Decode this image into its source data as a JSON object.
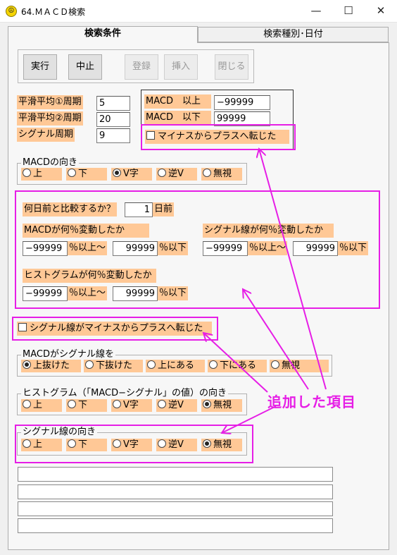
{
  "window": {
    "title": "64.ＭＡＣＤ検索",
    "app_icon_glyph": "☮",
    "minimize_glyph": "—",
    "maximize_glyph": "☐",
    "close_glyph": "✕"
  },
  "tabs": [
    "検索条件",
    "検索種別･日付"
  ],
  "buttons": {
    "run": "実行",
    "stop": "中止",
    "register": "登録",
    "insert": "挿入",
    "close": "閉じる"
  },
  "periods": {
    "smooth1_label": "平滑平均①周期",
    "smooth1_value": "5",
    "smooth2_label": "平滑平均②周期",
    "smooth2_value": "20",
    "signal_label": "シグナル周期",
    "signal_value": "9"
  },
  "macd_range": {
    "upper_label": "MACD　以上",
    "upper_value": "−99999",
    "lower_label": "MACD　以下",
    "lower_value": "99999",
    "minus_to_plus_label": "マイナスからプラスへ転じた"
  },
  "macd_direction": {
    "title": "MACDの向き",
    "options": [
      "上",
      "下",
      "V字",
      "逆V",
      "無視"
    ],
    "selected": 2
  },
  "compare": {
    "question_label": "何日前と比較するか？",
    "days_value": "1",
    "days_unit": "日前",
    "macd_change_label": "MACDが何％変動したか",
    "macd_min": "−99999",
    "macd_min_suffix": "％以上〜",
    "macd_max": "99999",
    "macd_max_suffix": "％以下",
    "signal_change_label": "シグナル線が何％変動したか",
    "signal_min": "−99999",
    "signal_min_suffix": "％以上〜",
    "signal_max": "99999",
    "signal_max_suffix": "％以下",
    "hist_change_label": "ヒストグラムが何％変動したか",
    "hist_min": "−99999",
    "hist_min_suffix": "％以上〜",
    "hist_max": "99999",
    "hist_max_suffix": "％以下"
  },
  "signal_minus_to_plus_label": "シグナル線がマイナスからプラスへ転じた",
  "macd_vs_signal": {
    "title": "MACDがシグナル線を",
    "options": [
      "上抜けた",
      "下抜けた",
      "上にある",
      "下にある",
      "無視"
    ],
    "selected": 0
  },
  "hist_direction": {
    "title": "ヒストグラム（「MACD−シグナル」の値）の向き",
    "options": [
      "上",
      "下",
      "V字",
      "逆V",
      "無視"
    ],
    "selected": 4
  },
  "signal_direction": {
    "title": "シグナル線の向き",
    "options": [
      "上",
      "下",
      "V字",
      "逆V",
      "無視"
    ],
    "selected": 4
  },
  "annotation": "追加した項目",
  "colors": {
    "label_bg": "#ffc896",
    "highlight": "#e61ee6"
  }
}
